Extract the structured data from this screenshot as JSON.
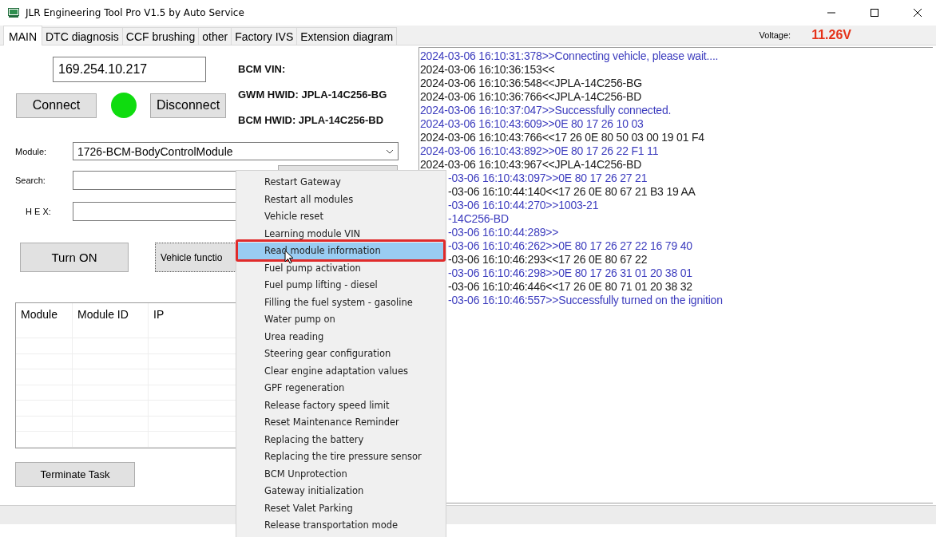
{
  "window": {
    "title": "JLR Engineering Tool Pro V1.5 by Auto Service"
  },
  "tabs": [
    {
      "label": "MAIN",
      "selected": true
    },
    {
      "label": "DTC diagnosis",
      "selected": false
    },
    {
      "label": "CCF brushing",
      "selected": false
    },
    {
      "label": "other",
      "selected": false
    },
    {
      "label": "Factory IVS",
      "selected": false
    },
    {
      "label": "Extension diagram",
      "selected": false
    }
  ],
  "voltage": {
    "label": "Voltage:",
    "value": "11.26V"
  },
  "connection": {
    "ip": "169.254.10.217",
    "connect": "Connect",
    "disconnect": "Disconnect",
    "connected": true
  },
  "info": [
    "BCM VIN:",
    "GWM HWID: JPLA-14C256-BG",
    "BCM HWID: JPLA-14C256-BD"
  ],
  "module": {
    "label": "Module:",
    "value": "1726-BCM-BodyControlModule"
  },
  "search": {
    "label": "Search:"
  },
  "hex": {
    "label": "H E X:"
  },
  "buttons": {
    "turn_on": "Turn ON",
    "vehicle": "Vehicle functio",
    "terminate": "Terminate Task"
  },
  "table": {
    "columns": [
      "Module",
      "Module ID",
      "IP"
    ]
  },
  "log": [
    {
      "text": "2024-03-06 16:10:31:378>>Connecting vehicle, please wait....",
      "kind": "sent",
      "clipped": false
    },
    {
      "text": "2024-03-06 16:10:36:153<<",
      "kind": "received",
      "clipped": false
    },
    {
      "text": "2024-03-06 16:10:36:548<<JPLA-14C256-BG",
      "kind": "received",
      "clipped": false
    },
    {
      "text": "2024-03-06 16:10:36:766<<JPLA-14C256-BD",
      "kind": "received",
      "clipped": false
    },
    {
      "text": "2024-03-06 16:10:37:047>>Successfully connected.",
      "kind": "sent",
      "clipped": false
    },
    {
      "text": "2024-03-06 16:10:43:609>>0E 80 17 26 10 03",
      "kind": "sent",
      "clipped": false
    },
    {
      "text": "2024-03-06 16:10:43:766<<17 26 0E 80 50 03 00 19 01 F4",
      "kind": "received",
      "clipped": false
    },
    {
      "text": "2024-03-06 16:10:43:892>>0E 80 17 26 22 F1 11",
      "kind": "sent",
      "clipped": false
    },
    {
      "text": "2024-03-06 16:10:43:967<<JPLA-14C256-BD",
      "kind": "received",
      "clipped": false
    },
    {
      "text": "-03-06 16:10:43:097>>0E 80 17 26 27 21",
      "kind": "sent",
      "clipped": true
    },
    {
      "text": "-03-06 16:10:44:140<<17 26 0E 80 67 21 B3 19 AA",
      "kind": "received",
      "clipped": true
    },
    {
      "text": "-03-06 16:10:44:270>>1003-21",
      "kind": "sent",
      "clipped": true
    },
    {
      "text": "-14C256-BD",
      "kind": "sent",
      "clipped": true
    },
    {
      "text": "-03-06 16:10:44:289>>",
      "kind": "sent",
      "clipped": true
    },
    {
      "text": "-03-06 16:10:46:262>>0E 80 17 26 27 22 16 79 40",
      "kind": "sent",
      "clipped": true
    },
    {
      "text": "-03-06 16:10:46:293<<17 26 0E 80 67 22",
      "kind": "received",
      "clipped": true
    },
    {
      "text": "-03-06 16:10:46:298>>0E 80 17 26 31 01 20 38 01",
      "kind": "sent",
      "clipped": true
    },
    {
      "text": "-03-06 16:10:46:446<<17 26 0E 80 71 01 20 38 32",
      "kind": "received",
      "clipped": true
    },
    {
      "text": "-03-06 16:10:46:557>>Successfully turned on the ignition",
      "kind": "sent",
      "clipped": true
    }
  ],
  "context_menu": [
    {
      "label": "Restart Gateway",
      "selected": false
    },
    {
      "label": "Restart all modules",
      "selected": false
    },
    {
      "label": "Vehicle reset",
      "selected": false
    },
    {
      "label": "Learning module VIN",
      "selected": false
    },
    {
      "label": "Read module information",
      "selected": true
    },
    {
      "label": "Fuel pump activation",
      "selected": false
    },
    {
      "label": "Fuel pump lifting - diesel",
      "selected": false
    },
    {
      "label": "Filling the fuel system - gasoline",
      "selected": false
    },
    {
      "label": "Water pump on",
      "selected": false
    },
    {
      "label": "Urea reading",
      "selected": false
    },
    {
      "label": "Steering gear configuration",
      "selected": false
    },
    {
      "label": "Clear engine adaptation values",
      "selected": false
    },
    {
      "label": "GPF regeneration",
      "selected": false
    },
    {
      "label": "Release factory speed limit",
      "selected": false
    },
    {
      "label": "Reset Maintenance Reminder",
      "selected": false
    },
    {
      "label": "Replacing the battery",
      "selected": false
    },
    {
      "label": "Replacing the tire pressure sensor",
      "selected": false
    },
    {
      "label": "BCM Unprotection",
      "selected": false
    },
    {
      "label": "Gateway initialization",
      "selected": false
    },
    {
      "label": "Reset Valet Parking",
      "selected": false
    },
    {
      "label": "Release transportation mode",
      "selected": false
    }
  ]
}
